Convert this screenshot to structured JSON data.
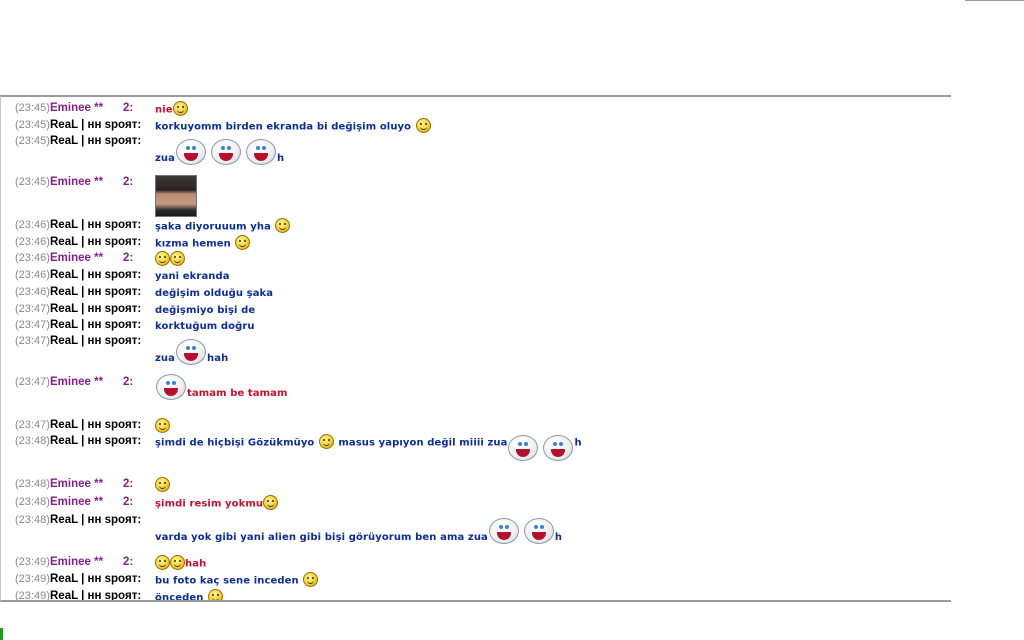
{
  "chat": {
    "lines": [
      {
        "time": "(23:45)",
        "name": "Eminee **",
        "num": "2:",
        "text": "nie"
      },
      {
        "time": "(23:45)",
        "name": "ReaL | нн spoят:",
        "text": "korkuyomm birden ekranda bi değişim oluyo"
      },
      {
        "time": "(23:45)",
        "name": "ReaL | нн spoят:",
        "pre": "zua",
        "post": "h"
      },
      {
        "time": "(23:45)",
        "name": "Eminee **",
        "num": "2:"
      },
      {
        "time": "(23:46)",
        "name": "ReaL | нн spoят:",
        "text": "şaka diyoruuum yha"
      },
      {
        "time": "(23:46)",
        "name": "ReaL | нн spoят:",
        "text": "kızma hemen"
      },
      {
        "time": "(23:46)",
        "name": "Eminee **",
        "num": "2:"
      },
      {
        "time": "(23:46)",
        "name": "ReaL | нн spoят:",
        "text": "yani ekranda"
      },
      {
        "time": "(23:46)",
        "name": "ReaL | нн spoят:",
        "text": "değişim olduğu şaka"
      },
      {
        "time": "(23:47)",
        "name": "ReaL | нн spoят:",
        "text": "değişmiyo bişi de"
      },
      {
        "time": "(23:47)",
        "name": "ReaL | нн spoят:",
        "text": "korktuğum doğru"
      },
      {
        "time": "(23:47)",
        "name": "ReaL | нн spoят:",
        "pre": "zua",
        "post": "hah"
      },
      {
        "time": "(23:47)",
        "name": "Eminee **",
        "num": "2:",
        "text": "tamam be tamam"
      },
      {
        "time": "(23:47)",
        "name": "ReaL | нн spoят:"
      },
      {
        "time": "(23:48)",
        "name": "ReaL | нн spoят:",
        "text": "şimdi de hiçbişi Gözükmüyo",
        "text2": "masus yapıyon değil miiii zua",
        "post": "h"
      },
      {
        "time": "(23:48)",
        "name": "Eminee **",
        "num": "2:"
      },
      {
        "time": "(23:48)",
        "name": "Eminee **",
        "num": "2:",
        "text": "şimdi resim yokmu"
      },
      {
        "time": "(23:48)",
        "name": "ReaL | нн spoят:",
        "text": "varda yok gibi yani alien gibi bişi görüyorum ben ama zua",
        "post": "h"
      },
      {
        "time": "(23:49)",
        "name": "Eminee **",
        "num": "2:",
        "text": "hah"
      },
      {
        "time": "(23:49)",
        "name": "ReaL | нн spoят:",
        "text": "bu foto kaç sene inceden"
      },
      {
        "time": "(23:49)",
        "name": "ReaL | нн spoят:",
        "text": "önceden"
      }
    ]
  },
  "colors": {
    "eminee": "#8a1f8a",
    "real": "#000000",
    "realtext": "#0b2d9c",
    "eminetext": "#c8102e",
    "border": "#9b9b9b"
  },
  "icons": [
    "smiley-icon",
    "ghost-emoticon-icon",
    "photo-thumbnail"
  ]
}
